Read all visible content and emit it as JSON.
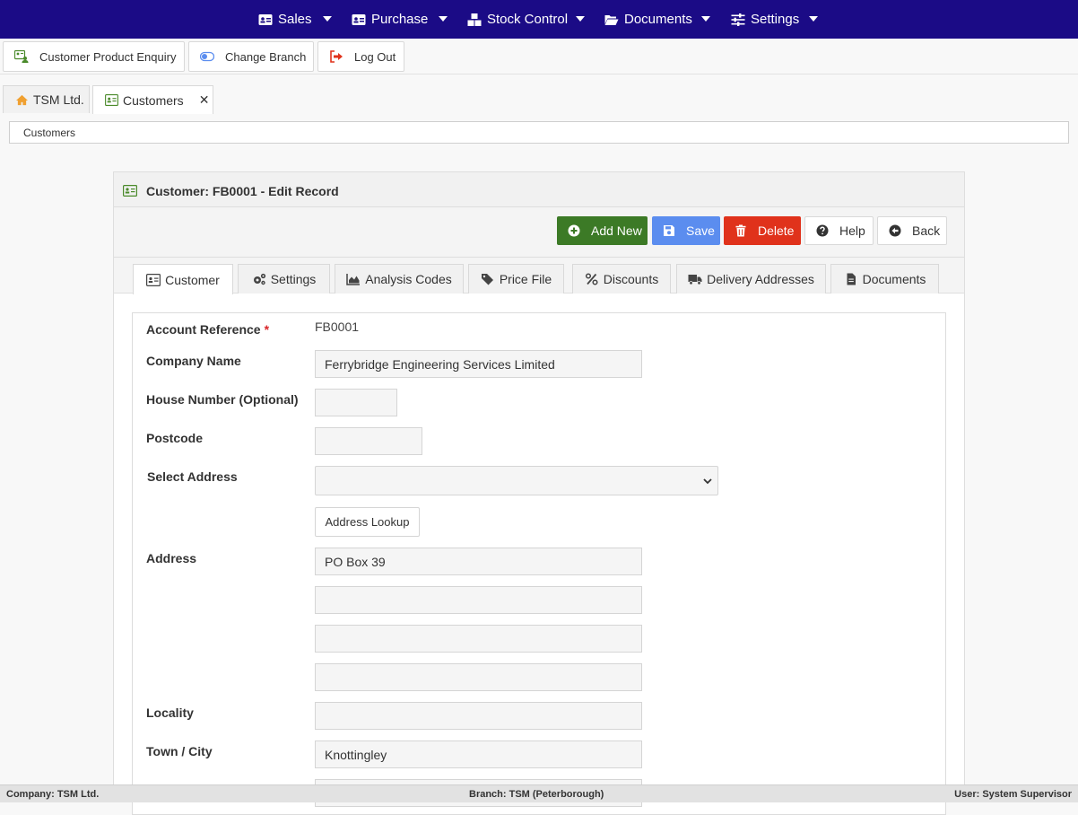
{
  "nav": {
    "items": [
      {
        "label": "Sales",
        "icon": "id-card-icon"
      },
      {
        "label": "Purchase",
        "icon": "id-card-icon"
      },
      {
        "label": "Stock Control",
        "icon": "boxes-icon"
      },
      {
        "label": "Documents",
        "icon": "folder-open-icon"
      },
      {
        "label": "Settings",
        "icon": "sliders-icon"
      }
    ]
  },
  "toolbar": {
    "customer_enquiry": "Customer Product Enquiry",
    "change_branch": "Change Branch",
    "log_out": "Log Out"
  },
  "doc_tabs": [
    {
      "label": "TSM Ltd.",
      "icon": "home-icon"
    },
    {
      "label": "Customers",
      "icon": "id-card-icon",
      "close": "✕"
    }
  ],
  "breadcrumb": "Customers",
  "panel": {
    "title": "Customer: FB0001 - Edit Record",
    "actions": {
      "add_new": "Add New",
      "save": "Save",
      "delete": "Delete",
      "help": "Help",
      "back": "Back"
    },
    "tabs": [
      {
        "label": "Customer",
        "icon": "id-card-icon",
        "active": true
      },
      {
        "label": "Settings",
        "icon": "cogs-icon"
      },
      {
        "label": "Analysis Codes",
        "icon": "chart-area-icon"
      },
      {
        "label": "Price File",
        "icon": "tags-icon"
      },
      {
        "label": "Discounts",
        "icon": "percent-icon"
      },
      {
        "label": "Delivery Addresses",
        "icon": "truck-icon"
      },
      {
        "label": "Documents",
        "icon": "file-icon"
      }
    ]
  },
  "form": {
    "account_reference": {
      "label": "Account Reference",
      "required_mark": "*",
      "value": "FB0001"
    },
    "company_name": {
      "label": "Company Name",
      "value": "Ferrybridge Engineering Services Limited"
    },
    "house_number": {
      "label": "House Number (Optional)",
      "value": ""
    },
    "postcode": {
      "label": "Postcode",
      "value": ""
    },
    "select_address": {
      "label": "Select Address",
      "value": ""
    },
    "address_lookup": "Address Lookup",
    "address": {
      "label": "Address",
      "line1": "PO Box 39",
      "line2": "",
      "line3": "",
      "line4": ""
    },
    "locality": {
      "label": "Locality",
      "value": ""
    },
    "town_city": {
      "label": "Town / City",
      "value": "Knottingley"
    }
  },
  "status": {
    "company": "Company: TSM Ltd.",
    "branch": "Branch: TSM (Peterborough)",
    "user": "User: System Supervisor"
  },
  "colors": {
    "nav_bg": "#1b0b86",
    "add_new": "#3c7a26",
    "save": "#5b8def",
    "delete": "#e0321b",
    "required": "#d9262a"
  }
}
